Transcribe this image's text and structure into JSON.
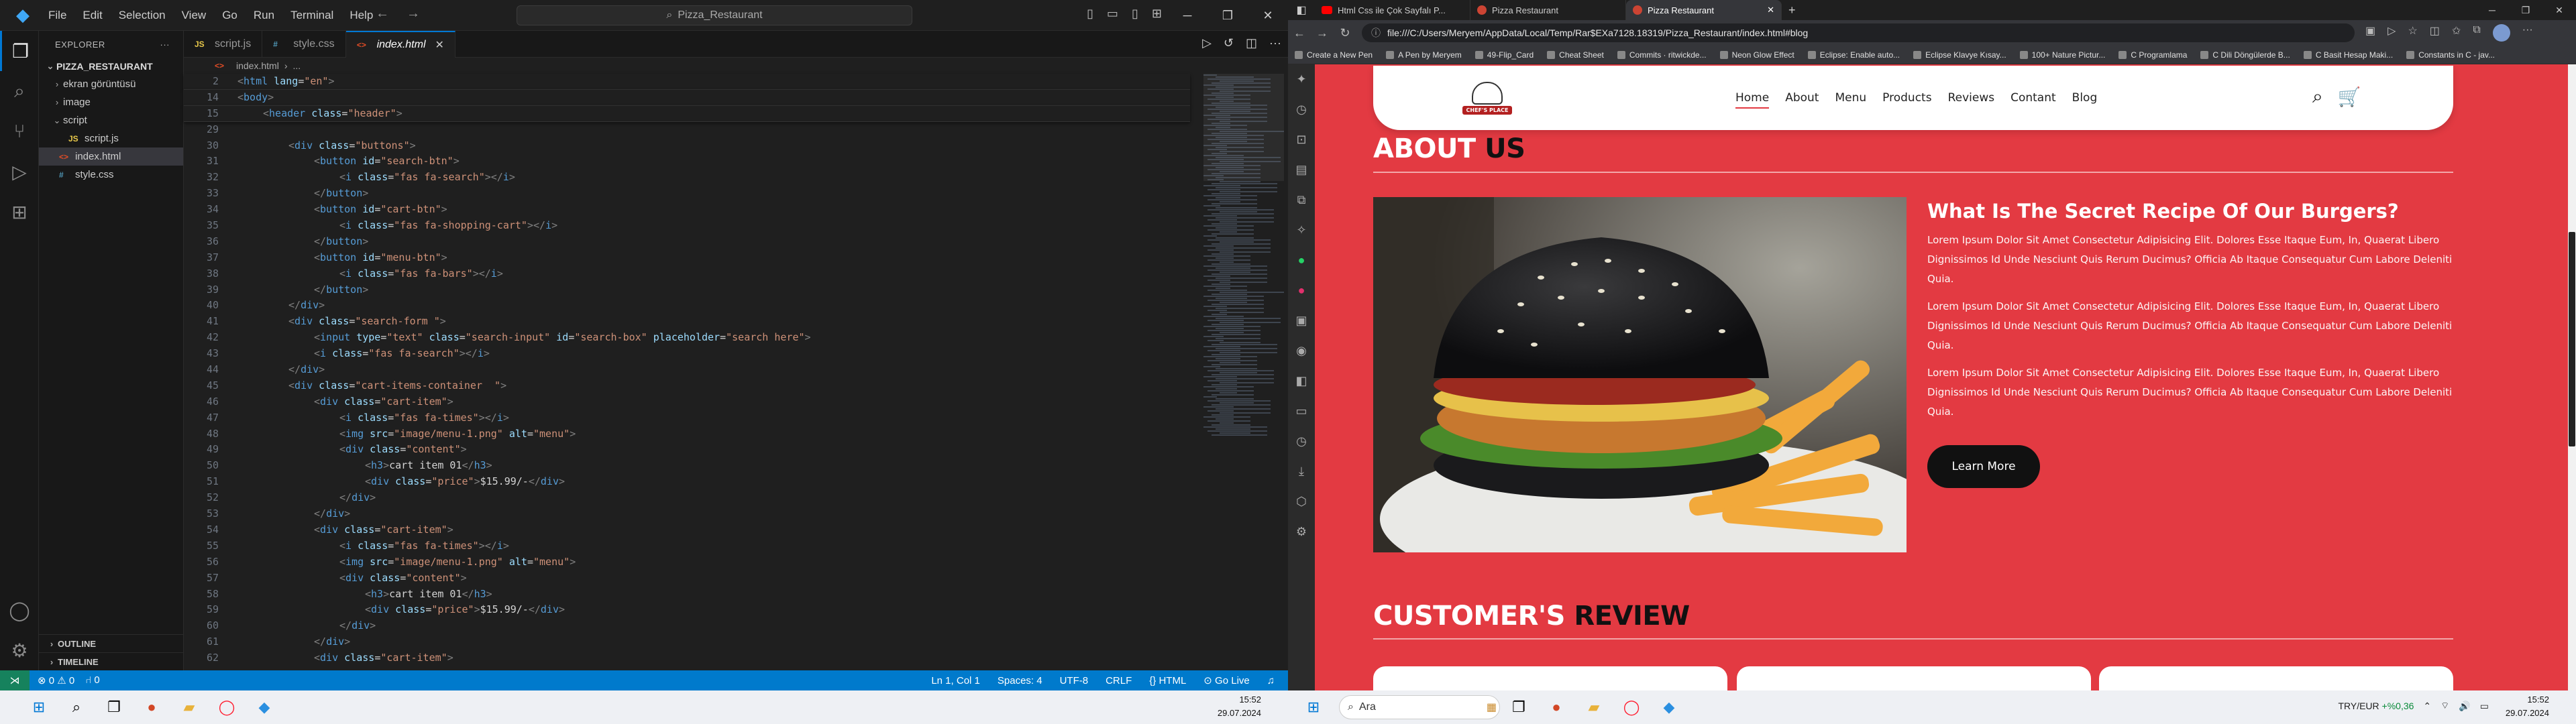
{
  "vscode": {
    "menu": [
      "File",
      "Edit",
      "Selection",
      "View",
      "Go",
      "Run",
      "Terminal",
      "Help"
    ],
    "search_text": "Pizza_Restaurant",
    "sidebar": {
      "title": "EXPLORER",
      "root": "PIZZA_RESTAURANT",
      "items": [
        {
          "label": "ekran görüntüsü",
          "type": "folder"
        },
        {
          "label": "image",
          "type": "folder"
        },
        {
          "label": "script",
          "type": "folder-open"
        },
        {
          "label": "script.js",
          "type": "js"
        },
        {
          "label": "index.html",
          "type": "html"
        },
        {
          "label": "style.css",
          "type": "css"
        }
      ],
      "outline": "OUTLINE",
      "timeline": "TIMELINE"
    },
    "tabs": [
      {
        "label": "script.js",
        "icon": "JS"
      },
      {
        "label": "style.css",
        "icon": "#"
      },
      {
        "label": "index.html",
        "icon": "<>"
      }
    ],
    "breadcrumb": [
      "index.html",
      "..."
    ],
    "status": {
      "errors": "0",
      "warnings": "0",
      "ports": "0",
      "position": "Ln 1, Col 1",
      "spaces": "Spaces: 4",
      "encoding": "UTF-8",
      "eol": "CRLF",
      "language": "HTML",
      "golive": "Go Live"
    }
  },
  "code_lines": [
    {
      "n": "2",
      "t": "<html lang=\"en\">",
      "i": 0
    },
    {
      "n": "14",
      "t": "<body>",
      "i": 0
    },
    {
      "n": "15",
      "t": "<header class=\"header\">",
      "i": 1
    },
    {
      "n": "29",
      "t": "",
      "i": 0
    },
    {
      "n": "30",
      "t": "<div class=\"buttons\">",
      "i": 2
    },
    {
      "n": "31",
      "t": "<button id=\"search-btn\">",
      "i": 3
    },
    {
      "n": "32",
      "t": "<i class=\"fas fa-search\"></i>",
      "i": 4
    },
    {
      "n": "33",
      "t": "</button>",
      "i": 3
    },
    {
      "n": "34",
      "t": "<button id=\"cart-btn\">",
      "i": 3
    },
    {
      "n": "35",
      "t": "<i class=\"fas fa-shopping-cart\"></i>",
      "i": 4
    },
    {
      "n": "36",
      "t": "</button>",
      "i": 3
    },
    {
      "n": "37",
      "t": "<button id=\"menu-btn\">",
      "i": 3
    },
    {
      "n": "38",
      "t": "<i class=\"fas fa-bars\"></i>",
      "i": 4
    },
    {
      "n": "39",
      "t": "</button>",
      "i": 3
    },
    {
      "n": "40",
      "t": "</div>",
      "i": 2
    },
    {
      "n": "41",
      "t": "<div class=\"search-form \">",
      "i": 2
    },
    {
      "n": "42",
      "t": "<input type=\"text\" class=\"search-input\" id=\"search-box\" placeholder=\"search here\">",
      "i": 3
    },
    {
      "n": "43",
      "t": "<i class=\"fas fa-search\"></i>",
      "i": 3
    },
    {
      "n": "44",
      "t": "</div>",
      "i": 2
    },
    {
      "n": "45",
      "t": "<div class=\"cart-items-container  \">",
      "i": 2
    },
    {
      "n": "46",
      "t": "<div class=\"cart-item\">",
      "i": 3
    },
    {
      "n": "47",
      "t": "<i class=\"fas fa-times\"></i>",
      "i": 4
    },
    {
      "n": "48",
      "t": "<img src=\"image/menu-1.png\" alt=\"menu\">",
      "i": 4
    },
    {
      "n": "49",
      "t": "<div class=\"content\">",
      "i": 4
    },
    {
      "n": "50",
      "t": "<h3>cart item 01</h3>",
      "i": 5
    },
    {
      "n": "51",
      "t": "<div class=\"price\">$15.99/-</div>",
      "i": 5
    },
    {
      "n": "52",
      "t": "</div>",
      "i": 4
    },
    {
      "n": "53",
      "t": "</div>",
      "i": 3
    },
    {
      "n": "54",
      "t": "<div class=\"cart-item\">",
      "i": 3
    },
    {
      "n": "55",
      "t": "<i class=\"fas fa-times\"></i>",
      "i": 4
    },
    {
      "n": "56",
      "t": "<img src=\"image/menu-1.png\" alt=\"menu\">",
      "i": 4
    },
    {
      "n": "57",
      "t": "<div class=\"content\">",
      "i": 4
    },
    {
      "n": "58",
      "t": "<h3>cart item 01</h3>",
      "i": 5
    },
    {
      "n": "59",
      "t": "<div class=\"price\">$15.99/-</div>",
      "i": 5
    },
    {
      "n": "60",
      "t": "</div>",
      "i": 4
    },
    {
      "n": "61",
      "t": "</div>",
      "i": 3
    },
    {
      "n": "62",
      "t": "<div class=\"cart-item\">",
      "i": 3
    }
  ],
  "browser": {
    "tabs": [
      {
        "label": "Html Css ile Çok Sayfalı P...",
        "fav": "yt"
      },
      {
        "label": "Pizza Restaurant",
        "fav": "pz"
      },
      {
        "label": "Pizza Restaurant",
        "fav": "pz",
        "active": true
      }
    ],
    "url": "file:///C:/Users/Meryem/AppData/Local/Temp/Rar$EXa7128.18319/Pizza_Restaurant/index.html#blog",
    "bookmarks": [
      "Create a New Pen",
      "A Pen by Meryem",
      "49-Flip_Card",
      "Cheat Sheet",
      "Commits · ritwickde...",
      "Neon Glow Effect",
      "Eclipse: Enable auto...",
      "Eclipse Klavye Kısay...",
      "100+ Nature Pictur...",
      "C Programlama",
      "C Dili Döngülerde B...",
      "C Basit Hesap Maki...",
      "Constants in C - jav..."
    ]
  },
  "site": {
    "logo_text": "CHEF'S PLACE",
    "nav": [
      "Home",
      "About",
      "Menu",
      "Products",
      "Reviews",
      "Contant",
      "Blog"
    ],
    "about_title_w": "ABOUT",
    "about_title_b": "US",
    "about_heading": "What Is The Secret Recipe Of Our Burgers?",
    "about_paragraphs": [
      "Lorem Ipsum Dolor Sit Amet Consectetur Adipisicing Elit. Dolores Esse Itaque Eum, In, Quaerat Libero Dignissimos Id Unde Nesciunt Quis Rerum Ducimus? Officia Ab Itaque Consequatur Cum Labore Deleniti Quia.",
      "Lorem Ipsum Dolor Sit Amet Consectetur Adipisicing Elit. Dolores Esse Itaque Eum, In, Quaerat Libero Dignissimos Id Unde Nesciunt Quis Rerum Ducimus? Officia Ab Itaque Consequatur Cum Labore Deleniti Quia.",
      "Lorem Ipsum Dolor Sit Amet Consectetur Adipisicing Elit. Dolores Esse Itaque Eum, In, Quaerat Libero Dignissimos Id Unde Nesciunt Quis Rerum Ducimus? Officia Ab Itaque Consequatur Cum Labore Deleniti Quia."
    ],
    "learn_more": "Learn More",
    "review_title_w": "CUSTOMER'S",
    "review_title_b": "REVIEW",
    "accent_color": "#e33a42"
  },
  "taskbar": {
    "left_time": "15:52",
    "left_date": "29.07.2024",
    "search_placeholder": "Ara",
    "currency": "TRY/EUR",
    "currency_change": "+%0,36",
    "right_time": "15:52",
    "right_date": "29.07.2024"
  }
}
